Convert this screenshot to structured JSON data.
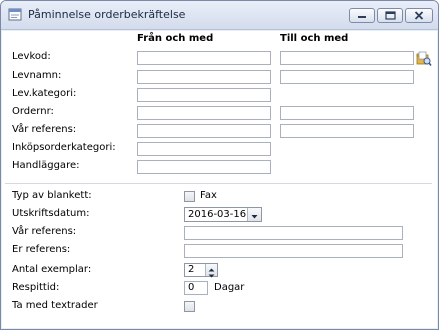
{
  "window": {
    "title": "Påminnelse orderbekräftelse"
  },
  "columns": {
    "from": "Från och med",
    "to": "Till och med"
  },
  "range_fields": [
    {
      "label": "Levkod:",
      "from_value": "",
      "to_value": ""
    },
    {
      "label": "Levnamn:",
      "from_value": "",
      "to_value": ""
    },
    {
      "label": "Lev.kategori:",
      "from_value": ""
    },
    {
      "label": "Ordernr:",
      "from_value": "",
      "to_value": ""
    },
    {
      "label": "Vår referens:",
      "from_value": "",
      "to_value": ""
    },
    {
      "label": "Inköpsorderkategori:",
      "from_value": ""
    },
    {
      "label": "Handläggare:",
      "from_value": ""
    }
  ],
  "options": {
    "blankett_label": "Typ av blankett:",
    "fax_label": "Fax",
    "fax_checked": false,
    "utskriftsdatum_label": "Utskriftsdatum:",
    "utskriftsdatum_value": "2016-03-16",
    "var_referens_label": "Vår referens:",
    "var_referens_value": "",
    "er_referens_label": "Er referens:",
    "er_referens_value": "",
    "antal_label": "Antal exemplar:",
    "antal_value": "2",
    "respittid_label": "Respittid:",
    "respittid_value": "0",
    "respittid_unit": "Dagar",
    "textrader_label": "Ta med textrader",
    "textrader_checked": false
  },
  "icons": {
    "app": "document-icon",
    "lookup": "folder-search-icon"
  }
}
